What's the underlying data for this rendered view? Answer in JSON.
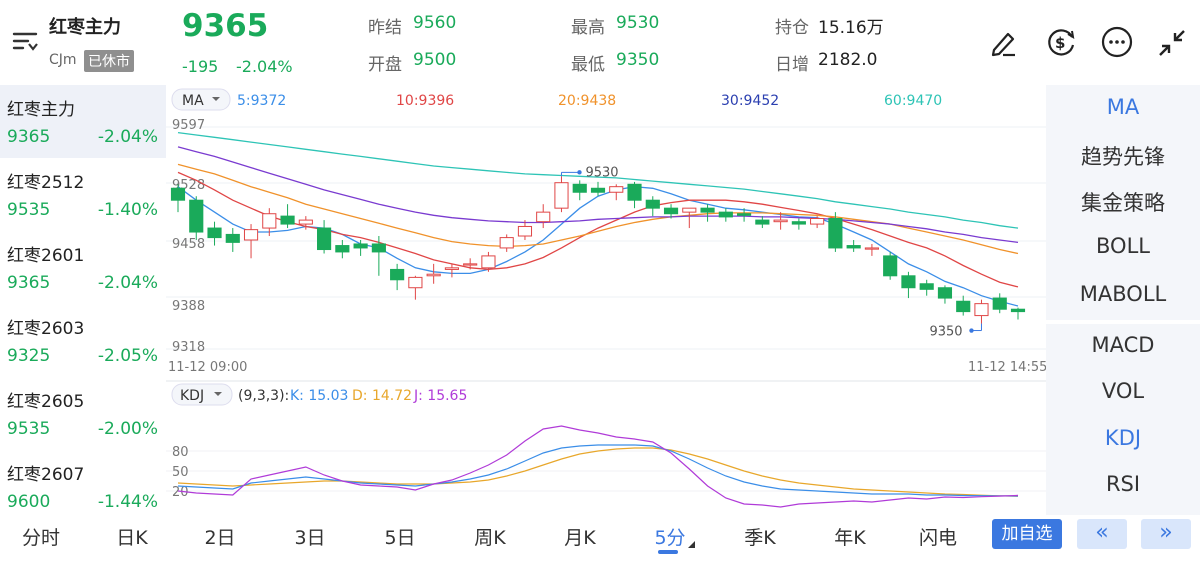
{
  "header": {
    "contract_name": "红枣主力",
    "code": "CJm",
    "status_badge": "已休市",
    "price": "9365",
    "change": "-195",
    "change_pct": "-2.04%",
    "stats": [
      {
        "label": "昨结",
        "value": "9560",
        "color": "#1aaa5a"
      },
      {
        "label": "开盘",
        "value": "9500",
        "color": "#1aaa5a"
      },
      {
        "label": "最高",
        "value": "9530",
        "color": "#1aaa5a"
      },
      {
        "label": "最低",
        "value": "9350",
        "color": "#1aaa5a"
      },
      {
        "label": "持仓",
        "value": "15.16万",
        "color": "#222"
      },
      {
        "label": "日增",
        "value": "2182.0",
        "color": "#222"
      }
    ],
    "icons": [
      "pen-icon",
      "currency-exchange-icon",
      "more-icon",
      "collapse-icon"
    ]
  },
  "contract_list": [
    {
      "name": "红枣主力",
      "price": "9365",
      "change_pct": "-2.04%"
    },
    {
      "name": "红枣2512",
      "price": "9535",
      "change_pct": "-1.40%"
    },
    {
      "name": "红枣2601",
      "price": "9365",
      "change_pct": "-2.04%"
    },
    {
      "name": "红枣2603",
      "price": "9325",
      "change_pct": "-2.05%"
    },
    {
      "name": "红枣2605",
      "price": "9535",
      "change_pct": "-2.00%"
    },
    {
      "name": "红枣2607",
      "price": "9600",
      "change_pct": "-1.44%"
    }
  ],
  "ma_legend": {
    "selector": "MA",
    "items": [
      {
        "label": "5:9372",
        "color": "#3b8ee8"
      },
      {
        "label": "10:9396",
        "color": "#e04646"
      },
      {
        "label": "20:9438",
        "color": "#f0922b"
      },
      {
        "label": "30:9452",
        "color": "#2b3fb0"
      },
      {
        "label": "60:9470",
        "color": "#2ec4b6"
      }
    ]
  },
  "kdj_legend": {
    "selector": "KDJ",
    "params": "(9,3,3):",
    "items": [
      {
        "label": "K: 15.03",
        "color": "#3b8ee8"
      },
      {
        "label": "D: 14.72",
        "color": "#e8a72b"
      },
      {
        "label": "J: 15.65",
        "color": "#b03bd8"
      }
    ]
  },
  "price_axis": [
    "9597",
    "9528",
    "9458",
    "9388",
    "9318"
  ],
  "time_start": "11-12 09:00",
  "time_end": "11-12 14:55",
  "max_label": "9530",
  "min_label": "9350",
  "kdj_axis": [
    "80",
    "50",
    "20"
  ],
  "chart_data": {
    "type": "candlestick",
    "ylim": [
      9318,
      9597
    ],
    "candles": [
      {
        "o": 9520,
        "h": 9525,
        "c": 9505,
        "l": 9490
      },
      {
        "o": 9505,
        "h": 9510,
        "c": 9465,
        "l": 9455
      },
      {
        "o": 9470,
        "h": 9478,
        "c": 9458,
        "l": 9448
      },
      {
        "o": 9462,
        "h": 9470,
        "c": 9452,
        "l": 9440
      },
      {
        "o": 9455,
        "h": 9475,
        "c": 9468,
        "l": 9432
      },
      {
        "o": 9470,
        "h": 9495,
        "c": 9488,
        "l": 9460
      },
      {
        "o": 9485,
        "h": 9500,
        "c": 9475,
        "l": 9470
      },
      {
        "o": 9475,
        "h": 9485,
        "c": 9480,
        "l": 9468
      },
      {
        "o": 9470,
        "h": 9480,
        "c": 9443,
        "l": 9438
      },
      {
        "o": 9448,
        "h": 9455,
        "c": 9440,
        "l": 9432
      },
      {
        "o": 9450,
        "h": 9455,
        "c": 9445,
        "l": 9435
      },
      {
        "o": 9450,
        "h": 9460,
        "c": 9440,
        "l": 9410
      },
      {
        "o": 9418,
        "h": 9425,
        "c": 9405,
        "l": 9392
      },
      {
        "o": 9395,
        "h": 9410,
        "c": 9408,
        "l": 9380
      },
      {
        "o": 9410,
        "h": 9425,
        "c": 9412,
        "l": 9400
      },
      {
        "o": 9418,
        "h": 9425,
        "c": 9420,
        "l": 9408
      },
      {
        "o": 9425,
        "h": 9432,
        "c": 9425,
        "l": 9418
      },
      {
        "o": 9420,
        "h": 9440,
        "c": 9435,
        "l": 9415
      },
      {
        "o": 9445,
        "h": 9462,
        "c": 9458,
        "l": 9440
      },
      {
        "o": 9460,
        "h": 9480,
        "c": 9472,
        "l": 9455
      },
      {
        "o": 9478,
        "h": 9500,
        "c": 9490,
        "l": 9470
      },
      {
        "o": 9495,
        "h": 9535,
        "c": 9527,
        "l": 9490
      },
      {
        "o": 9525,
        "h": 9530,
        "c": 9515,
        "l": 9505
      },
      {
        "o": 9520,
        "h": 9528,
        "c": 9515,
        "l": 9510
      },
      {
        "o": 9515,
        "h": 9525,
        "c": 9522,
        "l": 9505
      },
      {
        "o": 9525,
        "h": 9528,
        "c": 9505,
        "l": 9495
      },
      {
        "o": 9505,
        "h": 9510,
        "c": 9495,
        "l": 9485
      },
      {
        "o": 9495,
        "h": 9500,
        "c": 9488,
        "l": 9482
      },
      {
        "o": 9490,
        "h": 9495,
        "c": 9495,
        "l": 9470
      },
      {
        "o": 9495,
        "h": 9500,
        "c": 9490,
        "l": 9478
      },
      {
        "o": 9490,
        "h": 9495,
        "c": 9484,
        "l": 9478
      },
      {
        "o": 9488,
        "h": 9495,
        "c": 9486,
        "l": 9478
      },
      {
        "o": 9480,
        "h": 9485,
        "c": 9475,
        "l": 9470
      },
      {
        "o": 9478,
        "h": 9490,
        "c": 9480,
        "l": 9468
      },
      {
        "o": 9478,
        "h": 9482,
        "c": 9475,
        "l": 9468
      },
      {
        "o": 9475,
        "h": 9485,
        "c": 9482,
        "l": 9470
      },
      {
        "o": 9482,
        "h": 9490,
        "c": 9445,
        "l": 9440
      },
      {
        "o": 9448,
        "h": 9455,
        "c": 9445,
        "l": 9440
      },
      {
        "o": 9445,
        "h": 9450,
        "c": 9445,
        "l": 9435
      },
      {
        "o": 9435,
        "h": 9440,
        "c": 9410,
        "l": 9405
      },
      {
        "o": 9410,
        "h": 9415,
        "c": 9395,
        "l": 9382
      },
      {
        "o": 9400,
        "h": 9405,
        "c": 9393,
        "l": 9385
      },
      {
        "o": 9395,
        "h": 9398,
        "c": 9382,
        "l": 9375
      },
      {
        "o": 9378,
        "h": 9385,
        "c": 9365,
        "l": 9360
      },
      {
        "o": 9360,
        "h": 9380,
        "c": 9375,
        "l": 9350
      },
      {
        "o": 9382,
        "h": 9388,
        "c": 9368,
        "l": 9363
      },
      {
        "o": 9368,
        "h": 9370,
        "c": 9365,
        "l": 9355
      }
    ],
    "ma_series": [
      {
        "name": "5",
        "values": [
          9522,
          9505,
          9490,
          9475,
          9465,
          9465,
          9467,
          9472,
          9470,
          9462,
          9450,
          9445,
          9432,
          9420,
          9415,
          9413,
          9413,
          9418,
          9428,
          9440,
          9455,
          9475,
          9495,
          9510,
          9518,
          9522,
          9520,
          9513,
          9505,
          9500,
          9495,
          9493,
          9490,
          9487,
          9484,
          9483,
          9475,
          9465,
          9455,
          9440,
          9425,
          9415,
          9403,
          9395,
          9385,
          9378,
          9372
        ]
      },
      {
        "name": "10",
        "values": [
          9540,
          9530,
          9518,
          9505,
          9495,
          9485,
          9478,
          9472,
          9468,
          9462,
          9458,
          9452,
          9445,
          9438,
          9430,
          9425,
          9420,
          9418,
          9420,
          9425,
          9433,
          9445,
          9458,
          9470,
          9480,
          9490,
          9498,
          9502,
          9505,
          9505,
          9505,
          9503,
          9500,
          9496,
          9492,
          9488,
          9482,
          9475,
          9468,
          9460,
          9452,
          9445,
          9435,
          9423,
          9412,
          9402,
          9396
        ]
      },
      {
        "name": "20",
        "values": [
          9550,
          9544,
          9538,
          9530,
          9522,
          9515,
          9508,
          9500,
          9494,
          9488,
          9482,
          9476,
          9470,
          9464,
          9458,
          9453,
          9450,
          9448,
          9447,
          9448,
          9450,
          9455,
          9460,
          9466,
          9472,
          9477,
          9481,
          9484,
          9486,
          9488,
          9489,
          9489,
          9489,
          9488,
          9487,
          9486,
          9484,
          9481,
          9478,
          9475,
          9470,
          9465,
          9460,
          9455,
          9449,
          9443,
          9438
        ]
      },
      {
        "name": "30",
        "values": [
          9572,
          9566,
          9560,
          9553,
          9546,
          9539,
          9532,
          9525,
          9518,
          9512,
          9506,
          9500,
          9495,
          9490,
          9486,
          9483,
          9481,
          9479,
          9478,
          9477,
          9477,
          9478,
          9479,
          9481,
          9482,
          9483,
          9484,
          9484,
          9485,
          9485,
          9485,
          9485,
          9484,
          9484,
          9483,
          9482,
          9481,
          9479,
          9477,
          9475,
          9472,
          9469,
          9465,
          9462,
          9458,
          9455,
          9452
        ]
      },
      {
        "name": "60",
        "values": [
          9590,
          9587,
          9584,
          9581,
          9578,
          9575,
          9572,
          9569,
          9566,
          9563,
          9560,
          9557,
          9554,
          9551,
          9548,
          9546,
          9544,
          9542,
          9540,
          9538,
          9537,
          9536,
          9535,
          9534,
          9533,
          9531,
          9529,
          9527,
          9525,
          9523,
          9521,
          9519,
          9516,
          9513,
          9510,
          9507,
          9503,
          9500,
          9497,
          9494,
          9490,
          9487,
          9484,
          9480,
          9477,
          9473,
          9470
        ]
      }
    ],
    "kdj": {
      "K": [
        25,
        24,
        23,
        22,
        28,
        30,
        32,
        34,
        32,
        30,
        28,
        27,
        26,
        25,
        27,
        29,
        32,
        36,
        42,
        50,
        58,
        63,
        65,
        66,
        66,
        66,
        65,
        60,
        52,
        43,
        35,
        29,
        25,
        22,
        21,
        20,
        19,
        18,
        17,
        17,
        17,
        16,
        16,
        15.5,
        15.3,
        15.1,
        15.03
      ],
      "D": [
        28,
        27,
        26,
        25,
        26,
        27,
        28,
        29,
        30,
        30,
        29,
        28,
        27,
        27,
        27,
        28,
        29,
        31,
        35,
        40,
        46,
        52,
        57,
        60,
        62,
        63,
        63,
        61,
        57,
        52,
        46,
        40,
        35,
        31,
        28,
        26,
        24,
        22,
        21,
        20,
        19,
        18,
        17,
        16.5,
        15.8,
        15.2,
        14.72
      ],
      "J": [
        20,
        18,
        17,
        16,
        32,
        36,
        40,
        44,
        36,
        30,
        26,
        25,
        24,
        21,
        27,
        31,
        38,
        46,
        56,
        70,
        82,
        85,
        81,
        78,
        74,
        72,
        69,
        58,
        42,
        25,
        13,
        7,
        6,
        4,
        7,
        8,
        9,
        10,
        9,
        11,
        13,
        12,
        14,
        13.5,
        14.3,
        14.9,
        15.65
      ]
    }
  },
  "indicators": [
    {
      "label": "MA",
      "active": true
    },
    {
      "label": "趋势先锋",
      "active": false
    },
    {
      "label": "集金策略",
      "active": false
    },
    {
      "label": "BOLL",
      "active": false
    },
    {
      "label": "MABOLL",
      "active": false
    },
    {
      "label": "MACD",
      "active": false
    },
    {
      "label": "VOL",
      "active": false
    },
    {
      "label": "KDJ",
      "active": true
    },
    {
      "label": "RSI",
      "active": false
    }
  ],
  "period_tabs": [
    {
      "label": "分时",
      "active": false
    },
    {
      "label": "日K",
      "active": false
    },
    {
      "label": "2日",
      "active": false
    },
    {
      "label": "3日",
      "active": false
    },
    {
      "label": "5日",
      "active": false
    },
    {
      "label": "周K",
      "active": false
    },
    {
      "label": "月K",
      "active": false
    },
    {
      "label": "5分",
      "active": true
    },
    {
      "label": "季K",
      "active": false
    },
    {
      "label": "年K",
      "active": false
    },
    {
      "label": "闪电",
      "active": false
    }
  ],
  "add_watch_label": "加自选",
  "prev_label": "«",
  "next_label": "»"
}
